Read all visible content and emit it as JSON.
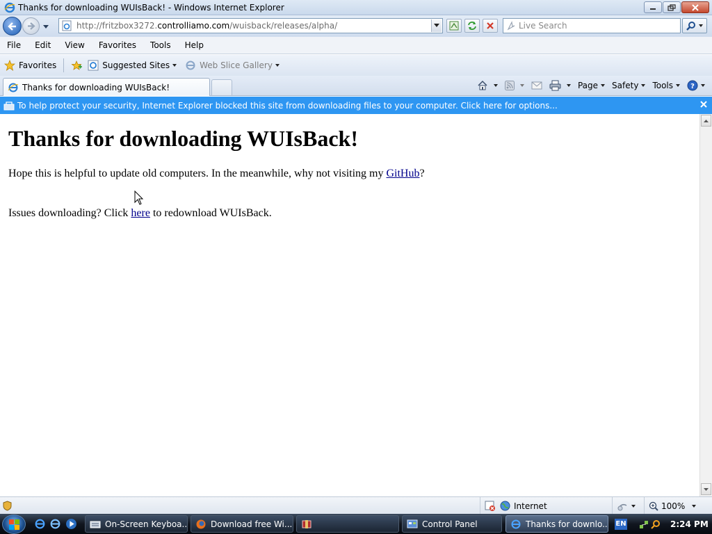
{
  "window": {
    "title": "Thanks for downloading WUIsBack! - Windows Internet Explorer"
  },
  "nav": {
    "url_prefix": "http://fritzbox3272.",
    "url_domain": "controlliamo.com",
    "url_path": "/wuisback/releases/alpha/",
    "search_placeholder": "Live Search"
  },
  "menu": {
    "items": [
      "File",
      "Edit",
      "View",
      "Favorites",
      "Tools",
      "Help"
    ]
  },
  "favorites_bar": {
    "favorites_label": "Favorites",
    "suggested_label": "Suggested Sites",
    "webslice_label": "Web Slice Gallery"
  },
  "tabs": {
    "active_label": "Thanks for downloading WUIsBack!"
  },
  "command_bar": {
    "page_label": "Page",
    "safety_label": "Safety",
    "tools_label": "Tools"
  },
  "infobar": {
    "message": "To help protect your security, Internet Explorer blocked this site from downloading files to your computer. Click here for options..."
  },
  "page": {
    "heading": "Thanks for downloading WUIsBack!",
    "p1_before": "Hope this is helpful to update old computers. In the meanwhile, why not visiting my ",
    "p1_link": "GitHub",
    "p1_after": "?",
    "p2_before": "Issues downloading? Click ",
    "p2_link": "here",
    "p2_after": " to redownload WUIsBack."
  },
  "status": {
    "zone": "Internet",
    "zoom": "100%"
  },
  "taskbar": {
    "tasks": [
      "On-Screen Keyboa...",
      "Download free Wi...",
      "",
      "Control Panel",
      "Thanks for downlo..."
    ],
    "lang": "EN",
    "clock": "2:24 PM"
  },
  "colors": {
    "infobar": "#2e96f2",
    "link": "#00008b"
  }
}
